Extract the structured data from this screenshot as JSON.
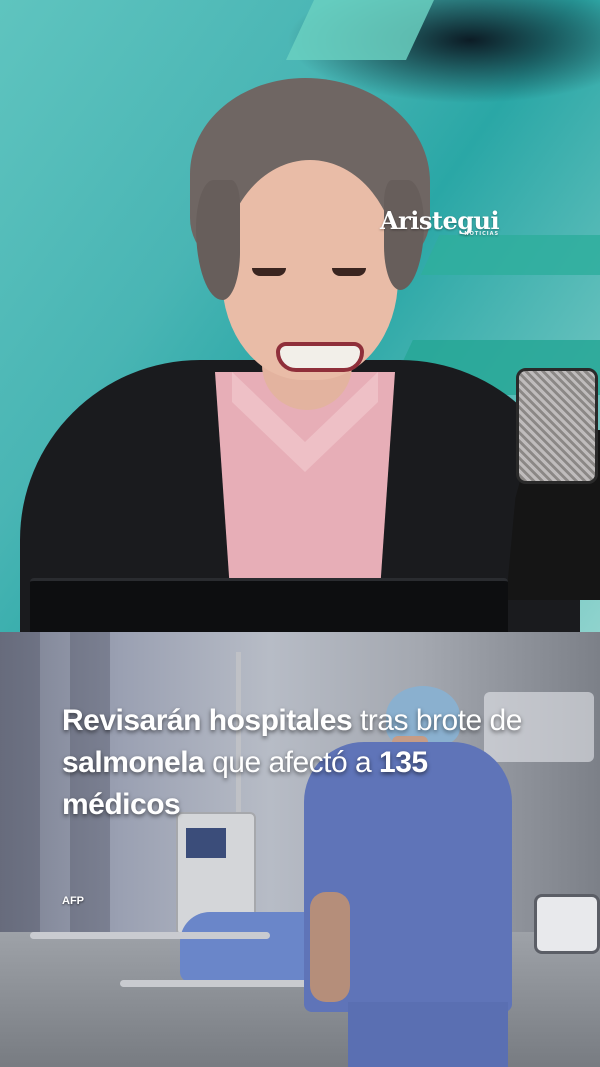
{
  "logo": {
    "brand": "Aristegui",
    "sub": "NOTICIAS"
  },
  "headline": {
    "part1_bold": "Revisarán hospitales",
    "part2": " tras brote de ",
    "part3_bold": "salmonela",
    "part4": " que afectó a ",
    "part5_bold": "135",
    "part6": " ",
    "part7_bold": "médicos"
  },
  "photo_credit": "AFP",
  "colors": {
    "studio_teal": "#49b5b4",
    "jacket": "#1a1b1e",
    "shirt_pink": "#e7aeb7",
    "scrubs_blue": "#5f74b8",
    "text_white": "#ffffff"
  }
}
